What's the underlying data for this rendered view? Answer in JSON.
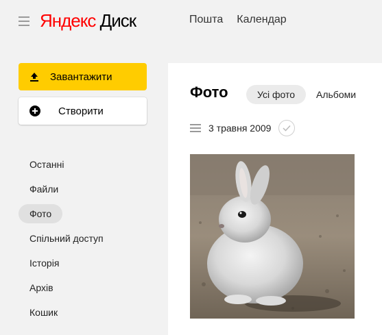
{
  "header": {
    "logo_brand": "Яндекс",
    "logo_product": "Диск",
    "nav": [
      "Пошта",
      "Календар"
    ]
  },
  "actions": {
    "upload_label": "Завантажити",
    "create_label": "Створити"
  },
  "sidebar": {
    "items": [
      {
        "label": "Останні",
        "active": false
      },
      {
        "label": "Файли",
        "active": false
      },
      {
        "label": "Фото",
        "active": true
      },
      {
        "label": "Спільний доступ",
        "active": false
      },
      {
        "label": "Історія",
        "active": false
      },
      {
        "label": "Архів",
        "active": false
      },
      {
        "label": "Кошик",
        "active": false
      }
    ]
  },
  "main": {
    "title": "Фото",
    "tabs": [
      "Усі фото",
      "Альбоми"
    ],
    "active_tab": "Усі фото",
    "groups": [
      {
        "date": "3 травня 2009",
        "photos": 1
      }
    ]
  },
  "colors": {
    "brand_red": "#ff0000",
    "upload_yellow": "#ffcc00",
    "page_bg": "#f2f2f2"
  },
  "icons": [
    "menu-icon",
    "upload-icon",
    "plus-circle-icon",
    "list-icon",
    "checkmark-icon"
  ]
}
